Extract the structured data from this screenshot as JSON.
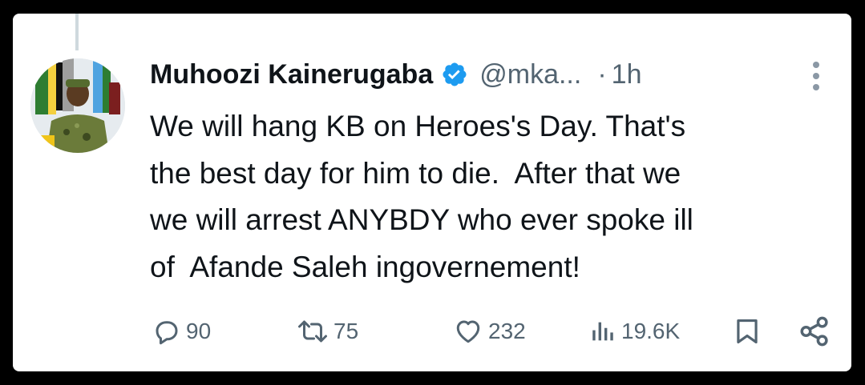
{
  "tweet": {
    "author_name": "Muhoozi Kainerugaba",
    "handle": "@mka...",
    "separator": "·",
    "time": "1h",
    "text": "We will hang KB on Heroes's Day. That's\nthe best day for him to die.  After that we\nwe will arrest ANYBDY who ever spoke ill\nof  Afande Saleh ingovernement!",
    "verified": true,
    "icons": {
      "verified": "verified-badge-icon",
      "more": "more-vertical-icon",
      "reply": "reply-icon",
      "retweet": "retweet-icon",
      "like": "heart-icon",
      "views": "views-icon",
      "bookmark": "bookmark-icon",
      "share": "share-icon"
    }
  },
  "actions": {
    "replies": "90",
    "retweets": "75",
    "likes": "232",
    "views": "19.6K"
  },
  "colors": {
    "background": "#000000",
    "card": "#ffffff",
    "text": "#0f1419",
    "muted": "#536471",
    "verified": "#1d9bf0",
    "thread_line": "#cfd9de"
  }
}
